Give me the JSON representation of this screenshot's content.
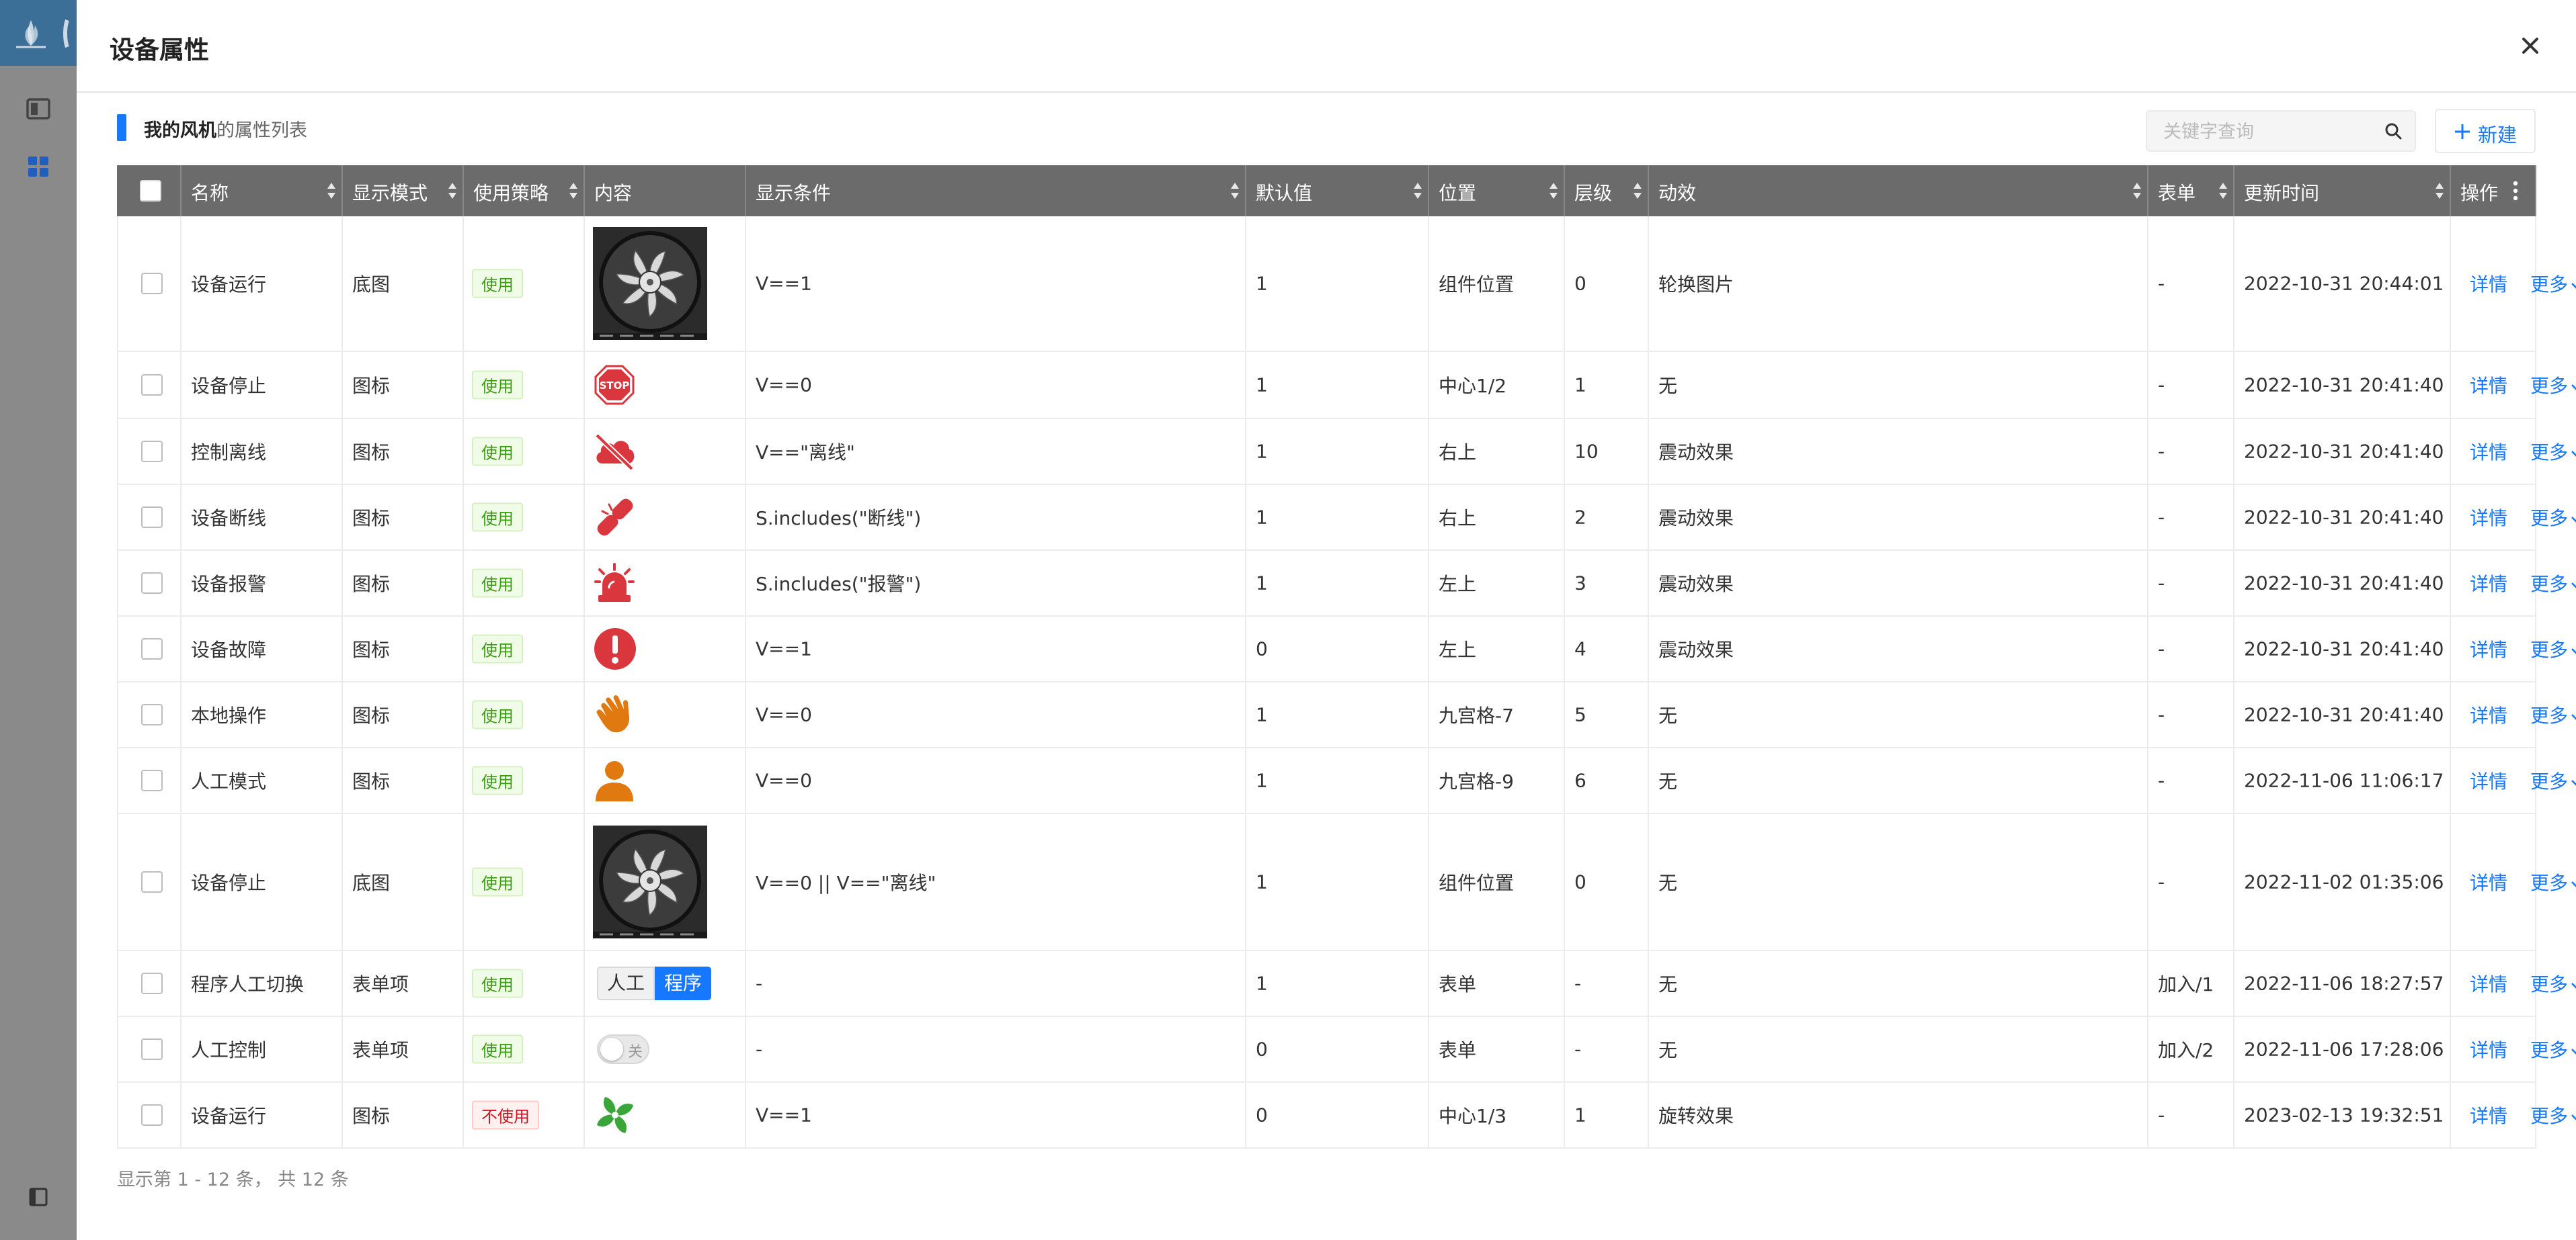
{
  "modal": {
    "title": "设备属性",
    "subtitle_bold": "我的风机",
    "subtitle_rest": "的属性列表",
    "search_placeholder": "关键字查询",
    "new_button": "新建"
  },
  "table": {
    "headers": [
      "名称",
      "显示模式",
      "使用策略",
      "内容",
      "显示条件",
      "默认值",
      "位置",
      "层级",
      "动效",
      "表单",
      "更新时间",
      "操作"
    ],
    "rows": [
      {
        "name": "设备运行",
        "mode": "底图",
        "policy": "使用",
        "policy_state": "use",
        "content_icon": "fan-image-icon",
        "cond": "V==1",
        "default": "1",
        "pos": "组件位置",
        "layer": "0",
        "effect": "轮换图片",
        "form": "-",
        "time": "2022-10-31 20:44:01",
        "detail": "详情",
        "more": "更多"
      },
      {
        "name": "设备停止",
        "mode": "图标",
        "policy": "使用",
        "policy_state": "use",
        "content_icon": "stop-sign-icon",
        "stop_text": "STOP",
        "cond": "V==0",
        "default": "1",
        "pos": "中心1/2",
        "layer": "1",
        "effect": "无",
        "form": "-",
        "time": "2022-10-31 20:41:40",
        "detail": "详情",
        "more": "更多"
      },
      {
        "name": "控制离线",
        "mode": "图标",
        "policy": "使用",
        "policy_state": "use",
        "content_icon": "cloud-offline-icon",
        "cond": "V==\"离线\"",
        "default": "1",
        "pos": "右上",
        "layer": "10",
        "effect": "震动效果",
        "form": "-",
        "time": "2022-10-31 20:41:40",
        "detail": "详情",
        "more": "更多"
      },
      {
        "name": "设备断线",
        "mode": "图标",
        "policy": "使用",
        "policy_state": "use",
        "content_icon": "broken-link-icon",
        "cond": "S.includes(\"断线\")",
        "default": "1",
        "pos": "右上",
        "layer": "2",
        "effect": "震动效果",
        "form": "-",
        "time": "2022-10-31 20:41:40",
        "detail": "详情",
        "more": "更多"
      },
      {
        "name": "设备报警",
        "mode": "图标",
        "policy": "使用",
        "policy_state": "use",
        "content_icon": "alarm-light-icon",
        "cond": "S.includes(\"报警\")",
        "default": "1",
        "pos": "左上",
        "layer": "3",
        "effect": "震动效果",
        "form": "-",
        "time": "2022-10-31 20:41:40",
        "detail": "详情",
        "more": "更多"
      },
      {
        "name": "设备故障",
        "mode": "图标",
        "policy": "使用",
        "policy_state": "use",
        "content_icon": "exclamation-circle-icon",
        "cond": "V==1",
        "default": "0",
        "pos": "左上",
        "layer": "4",
        "effect": "震动效果",
        "form": "-",
        "time": "2022-10-31 20:41:40",
        "detail": "详情",
        "more": "更多"
      },
      {
        "name": "本地操作",
        "mode": "图标",
        "policy": "使用",
        "policy_state": "use",
        "content_icon": "hand-icon",
        "cond": "V==0",
        "default": "1",
        "pos": "九宫格-7",
        "layer": "5",
        "effect": "无",
        "form": "-",
        "time": "2022-10-31 20:41:40",
        "detail": "详情",
        "more": "更多"
      },
      {
        "name": "人工模式",
        "mode": "图标",
        "policy": "使用",
        "policy_state": "use",
        "content_icon": "person-icon",
        "cond": "V==0",
        "default": "1",
        "pos": "九宫格-9",
        "layer": "6",
        "effect": "无",
        "form": "-",
        "time": "2022-11-06 11:06:17",
        "detail": "详情",
        "more": "更多"
      },
      {
        "name": "设备停止",
        "mode": "底图",
        "policy": "使用",
        "policy_state": "use",
        "content_icon": "fan-image-icon",
        "cond": "V==0 || V==\"离线\"",
        "default": "1",
        "pos": "组件位置",
        "layer": "0",
        "effect": "无",
        "form": "-",
        "time": "2022-11-02 01:35:06",
        "detail": "详情",
        "more": "更多"
      },
      {
        "name": "程序人工切换",
        "mode": "表单项",
        "policy": "使用",
        "policy_state": "use",
        "content_icon": "segmented-control",
        "seg_left": "人工",
        "seg_right": "程序",
        "cond": "-",
        "default": "1",
        "pos": "表单",
        "layer": "-",
        "effect": "无",
        "form": "加入/1",
        "time": "2022-11-06 18:27:57",
        "detail": "详情",
        "more": "更多"
      },
      {
        "name": "人工控制",
        "mode": "表单项",
        "policy": "使用",
        "policy_state": "use",
        "content_icon": "toggle-switch",
        "switch_text": "关",
        "cond": "-",
        "default": "0",
        "pos": "表单",
        "layer": "-",
        "effect": "无",
        "form": "加入/2",
        "time": "2022-11-06 17:28:06",
        "detail": "详情",
        "more": "更多"
      },
      {
        "name": "设备运行",
        "mode": "图标",
        "policy": "不使用",
        "policy_state": "nouse",
        "content_icon": "pinwheel-fan-icon",
        "cond": "V==1",
        "default": "0",
        "pos": "中心1/3",
        "layer": "1",
        "effect": "旋转效果",
        "form": "-",
        "time": "2023-02-13 19:32:51",
        "detail": "详情",
        "more": "更多"
      }
    ]
  },
  "footer": "显示第 1 - 12 条，  共 12 条",
  "colors": {
    "accent": "#1677ff",
    "header_bg": "#6b6b6b",
    "danger_red": "#d9363e",
    "orange": "#e07a10",
    "green": "#3aa63a"
  }
}
